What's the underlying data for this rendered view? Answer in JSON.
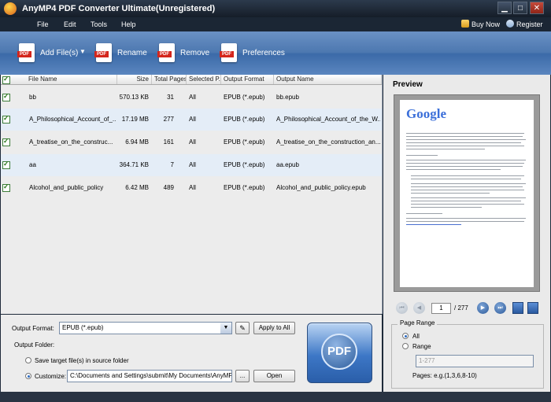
{
  "window": {
    "title": "AnyMP4 PDF Converter Ultimate(Unregistered)",
    "controls": [
      "▁",
      "□",
      "✕"
    ]
  },
  "menu": {
    "items": [
      "File",
      "Edit",
      "Tools",
      "Help"
    ],
    "buy_now": "Buy Now",
    "register": "Register"
  },
  "toolbar": {
    "add_files": "Add File(s)",
    "rename": "Rename",
    "remove": "Remove",
    "preferences": "Preferences"
  },
  "file_list": {
    "columns": [
      "File Name",
      "Size",
      "Total Pages",
      "Selected P.",
      "Output Format",
      "Output Name"
    ],
    "rows": [
      {
        "name": "bb",
        "size": "570.13 KB",
        "pages": "31",
        "selected": "All",
        "format": "EPUB (*.epub)",
        "output": "bb.epub"
      },
      {
        "name": "A_Philosophical_Account_of_...",
        "size": "17.19 MB",
        "pages": "277",
        "selected": "All",
        "format": "EPUB (*.epub)",
        "output": "A_Philosophical_Account_of_the_W..."
      },
      {
        "name": "A_treatise_on_the_construc...",
        "size": "6.94 MB",
        "pages": "161",
        "selected": "All",
        "format": "EPUB (*.epub)",
        "output": "A_treatise_on_the_construction_an..."
      },
      {
        "name": "aa",
        "size": "364.71 KB",
        "pages": "7",
        "selected": "All",
        "format": "EPUB (*.epub)",
        "output": "aa.epub"
      },
      {
        "name": "Alcohol_and_public_policy",
        "size": "6.42 MB",
        "pages": "489",
        "selected": "All",
        "format": "EPUB (*.epub)",
        "output": "Alcohol_and_public_policy.epub"
      }
    ]
  },
  "settings": {
    "output_format_label": "Output Format:",
    "output_format_value": "EPUB (*.epub)",
    "apply_to_all": "Apply to All",
    "output_folder_label": "Output Folder:",
    "save_in_source": "Save target file(s) in source folder",
    "customize_label": "Customize:",
    "customize_path": "C:\\Documents and Settings\\submit\\My Documents\\AnyMP4",
    "browse": "...",
    "open": "Open",
    "convert_text": "PDF"
  },
  "preview": {
    "title": "Preview",
    "doc_logo": "Google",
    "current_page": "1",
    "total_pages": "/ 277",
    "page_range_label": "Page Range",
    "all_label": "All",
    "range_label": "Range",
    "range_placeholder": "1-277",
    "pages_hint": "Pages: e.g.(1,3,6,8-10)"
  },
  "colors": {
    "toolbar": "#4d78b0",
    "alt_row": "#e4edf7",
    "pdf_red": "#d4261c"
  }
}
